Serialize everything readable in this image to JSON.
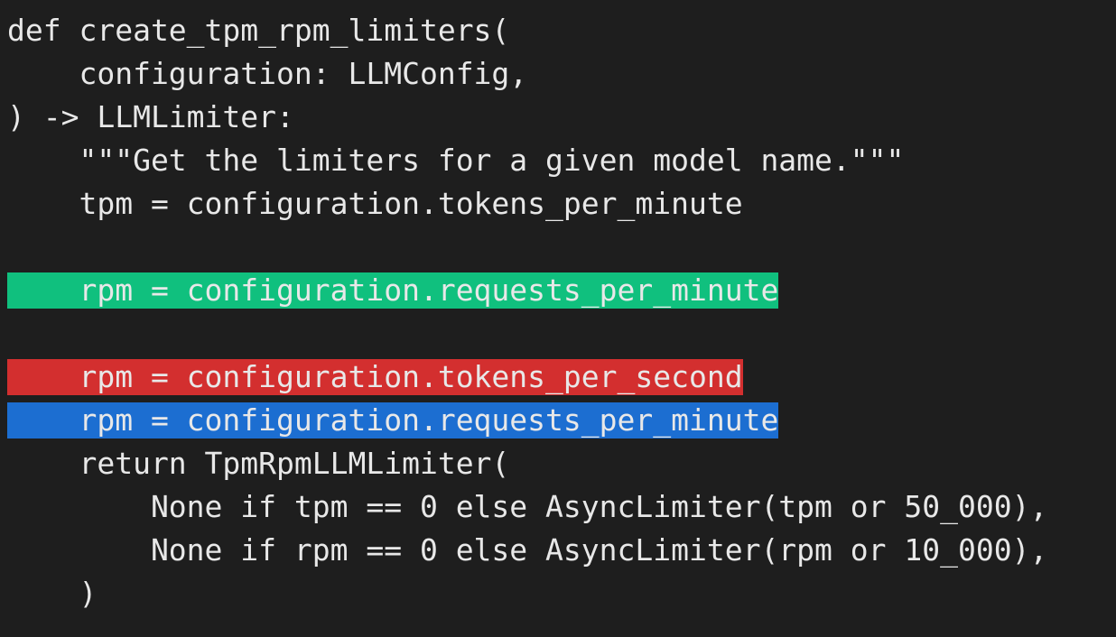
{
  "code": {
    "lines": [
      {
        "text": "def create_tpm_rpm_limiters(",
        "highlight": "none"
      },
      {
        "text": "    configuration: LLMConfig,",
        "highlight": "none"
      },
      {
        "text": ") -> LLMLimiter:",
        "highlight": "none"
      },
      {
        "text": "    \"\"\"Get the limiters for a given model name.\"\"\"",
        "highlight": "none"
      },
      {
        "text": "    tpm = configuration.tokens_per_minute",
        "highlight": "none"
      },
      {
        "text": "",
        "highlight": "none"
      },
      {
        "text": "    rpm = configuration.requests_per_minute",
        "highlight": "added",
        "color": "#10c07e"
      },
      {
        "text": "",
        "highlight": "none"
      },
      {
        "text": "    rpm = configuration.tokens_per_second",
        "highlight": "removed",
        "color": "#d32f2f"
      },
      {
        "text": "    rpm = configuration.requests_per_minute",
        "highlight": "selected",
        "color": "#1c6ed1"
      },
      {
        "text": "    return TpmRpmLLMLimiter(",
        "highlight": "none"
      },
      {
        "text": "        None if tpm == 0 else AsyncLimiter(tpm or 50_000),",
        "highlight": "none"
      },
      {
        "text": "        None if rpm == 0 else AsyncLimiter(rpm or 10_000),",
        "highlight": "none"
      },
      {
        "text": "    )",
        "highlight": "none"
      }
    ]
  },
  "colors": {
    "background": "#1e1e1e",
    "text": "#e8e8e8"
  }
}
